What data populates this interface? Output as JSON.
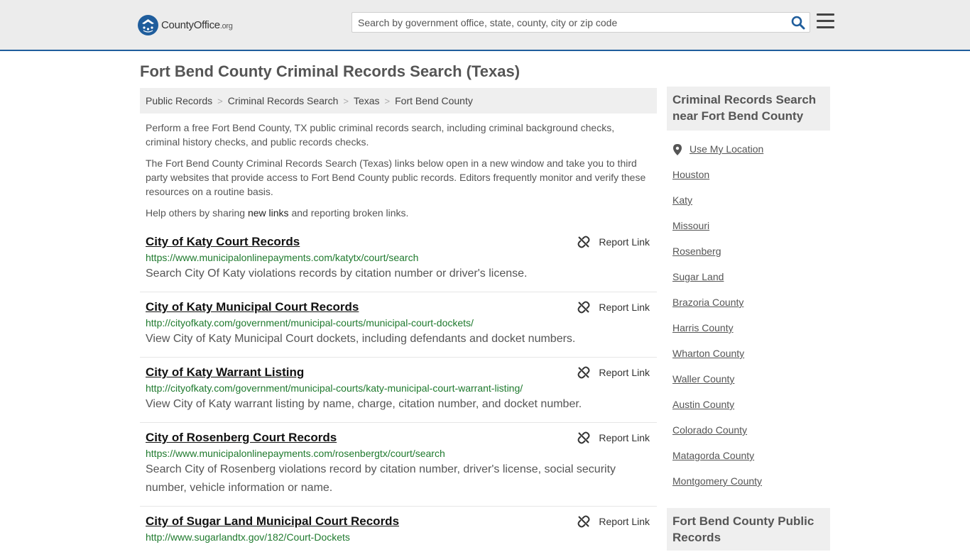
{
  "header": {
    "logo_text": "CountyOffice",
    "logo_tld": ".org",
    "search_placeholder": "Search by government office, state, county, city or zip code",
    "search_icon": "search-icon",
    "menu_icon": "hamburger-menu-icon"
  },
  "page": {
    "title": "Fort Bend County Criminal Records Search (Texas)"
  },
  "breadcrumb": [
    "Public Records",
    "Criminal Records Search",
    "Texas",
    "Fort Bend County"
  ],
  "intro": {
    "p1": "Perform a free Fort Bend County, TX public criminal records search, including criminal background checks, criminal history checks, and public records checks.",
    "p2": "The Fort Bend County Criminal Records Search (Texas) links below open in a new window and take you to third party websites that provide access to Fort Bend County public records. Editors frequently monitor and verify these resources on a routine basis.",
    "p3_before": "Help others by sharing ",
    "p3_link": "new links",
    "p3_after": " and reporting broken links."
  },
  "report_label": "Report Link",
  "results": [
    {
      "title": "City of Katy Court Records",
      "url": "https://www.municipalonlinepayments.com/katytx/court/search",
      "desc": "Search City Of Katy violations records by citation number or driver's license."
    },
    {
      "title": "City of Katy Municipal Court Records",
      "url": "http://cityofkaty.com/government/municipal-courts/municipal-court-dockets/",
      "desc": "View City of Katy Municipal Court dockets, including defendants and docket numbers."
    },
    {
      "title": "City of Katy Warrant Listing",
      "url": "http://cityofkaty.com/government/municipal-courts/katy-municipal-court-warrant-listing/",
      "desc": "View City of Katy warrant listing by name, charge, citation number, and docket number."
    },
    {
      "title": "City of Rosenberg Court Records",
      "url": "https://www.municipalonlinepayments.com/rosenbergtx/court/search",
      "desc": "Search City of Rosenberg violations record by citation number, driver's license, social security number, vehicle information or name."
    },
    {
      "title": "City of Sugar Land Municipal Court Records",
      "url": "http://www.sugarlandtx.gov/182/Court-Dockets",
      "desc": ""
    }
  ],
  "sidebar": {
    "nearby_title": "Criminal Records Search near Fort Bend County",
    "use_location": "Use My Location",
    "links": [
      "Houston",
      "Katy",
      "Missouri",
      "Rosenberg",
      "Sugar Land",
      "Brazoria County",
      "Harris County",
      "Wharton County",
      "Waller County",
      "Austin County",
      "Colorado County",
      "Matagorda County",
      "Montgomery County"
    ],
    "public_records_title": "Fort Bend County Public Records"
  },
  "colors": {
    "brand_blue": "#1f5d9c",
    "url_green": "#1f7a2e"
  }
}
